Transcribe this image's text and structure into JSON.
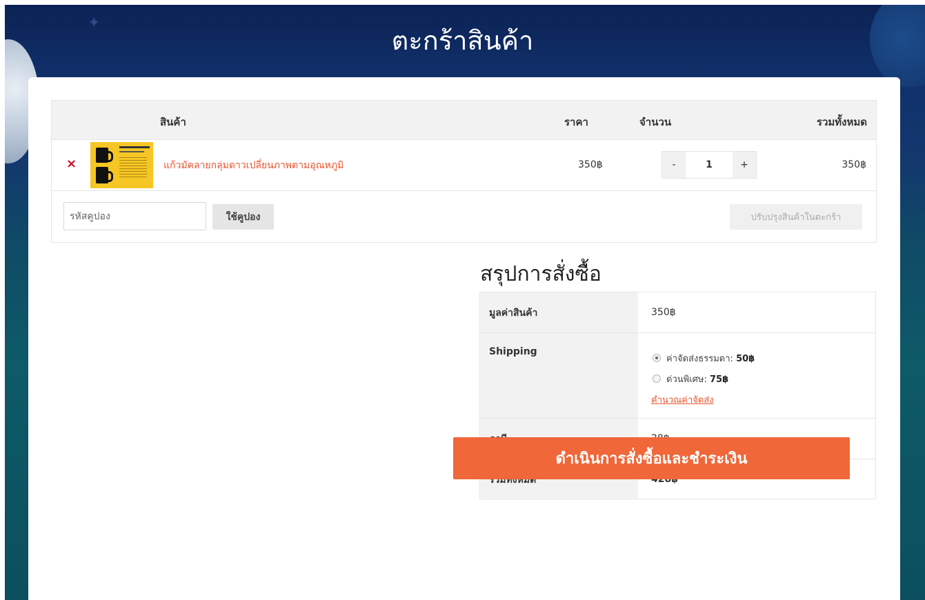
{
  "page": {
    "title": "ตะกร้าสินค้า"
  },
  "cart": {
    "headers": {
      "product": "สินค้า",
      "price": "ราคา",
      "quantity": "จำนวน",
      "total": "รวมทั้งหมด"
    },
    "items": [
      {
        "name": "แก้วมัคลายกลุ่มดาวเปลี่ยนภาพตามอุณหภูมิ",
        "price": "350฿",
        "quantity": "1",
        "total": "350฿",
        "remove_symbol": "×",
        "minus_label": "-",
        "plus_label": "+"
      }
    ],
    "coupon": {
      "placeholder": "รหัสคูปอง",
      "button_label": "ใช้คูปอง"
    },
    "update_label": "ปรับปรุงสินค้าในตะกร้า"
  },
  "summary": {
    "title": "สรุปการสั่งซื้อ",
    "subtotal": {
      "label": "มูลค่าสินค้า",
      "value": "350฿"
    },
    "shipping": {
      "label": "Shipping",
      "options": [
        {
          "label": "ค่าจัดส่งธรรมดา:",
          "price": "50฿",
          "selected": true
        },
        {
          "label": "ด่วนพิเศษ:",
          "price": "75฿",
          "selected": false
        }
      ],
      "calc_link": "คำนวณค่าจัดส่ง"
    },
    "tax": {
      "label": "ภาษี",
      "value": "28฿"
    },
    "total": {
      "label": "รวมทั้งหมด",
      "value": "428฿"
    }
  },
  "checkout": {
    "label": "ดำเนินการสั่งซื้อและชำระเงิน"
  },
  "colors": {
    "accent": "#f0673a",
    "link": "#e8552e",
    "remove": "#d0021b",
    "header_bg": "#0c2254"
  }
}
